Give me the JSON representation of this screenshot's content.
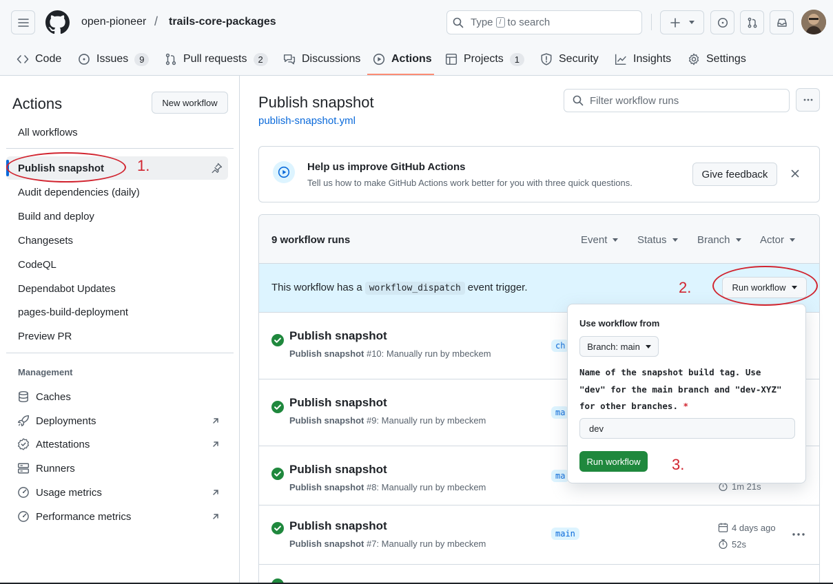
{
  "header": {
    "owner": "open-pioneer",
    "separator": "/",
    "repo": "trails-core-packages",
    "search": {
      "prefix": "Type",
      "key": "/",
      "suffix": "to search"
    }
  },
  "tabs": [
    {
      "label": "Code",
      "icon": "code-icon"
    },
    {
      "label": "Issues",
      "icon": "issue-icon",
      "count": "9"
    },
    {
      "label": "Pull requests",
      "icon": "pull-request-icon",
      "count": "2"
    },
    {
      "label": "Discussions",
      "icon": "discussions-icon"
    },
    {
      "label": "Actions",
      "icon": "play-icon",
      "active": true
    },
    {
      "label": "Projects",
      "icon": "table-icon",
      "count": "1"
    },
    {
      "label": "Security",
      "icon": "shield-icon"
    },
    {
      "label": "Insights",
      "icon": "graph-icon"
    },
    {
      "label": "Settings",
      "icon": "gear-icon"
    }
  ],
  "sidebar": {
    "title": "Actions",
    "new_workflow": "New workflow",
    "all_workflows": "All workflows",
    "workflows": [
      "Publish snapshot",
      "Audit dependencies (daily)",
      "Build and deploy",
      "Changesets",
      "CodeQL",
      "Dependabot Updates",
      "pages-build-deployment",
      "Preview PR"
    ],
    "management_title": "Management",
    "management": [
      {
        "label": "Caches",
        "icon": "database-icon"
      },
      {
        "label": "Deployments",
        "icon": "rocket-icon",
        "external": true
      },
      {
        "label": "Attestations",
        "icon": "verified-icon",
        "external": true
      },
      {
        "label": "Runners",
        "icon": "server-icon"
      },
      {
        "label": "Usage metrics",
        "icon": "meter-icon",
        "external": true
      },
      {
        "label": "Performance metrics",
        "icon": "meter-icon",
        "external": true
      }
    ]
  },
  "main": {
    "title": "Publish snapshot",
    "file": "publish-snapshot.yml",
    "filter_placeholder": "Filter workflow runs",
    "banner": {
      "title": "Help us improve GitHub Actions",
      "subtitle": "Tell us how to make GitHub Actions work better for you with three quick questions.",
      "button": "Give feedback"
    },
    "runs_count": "9 workflow runs",
    "filters": [
      "Event",
      "Status",
      "Branch",
      "Actor"
    ],
    "dispatch": {
      "before": "This workflow has a",
      "code": "workflow_dispatch",
      "after": "event trigger.",
      "button": "Run workflow"
    },
    "runs": [
      {
        "title": "Publish snapshot",
        "name": "Publish snapshot",
        "detail": "#10: Manually run by mbeckem",
        "branch": "ch"
      },
      {
        "title": "Publish snapshot",
        "name": "Publish snapshot",
        "detail": "#9: Manually run by mbeckem",
        "branch": "ma"
      },
      {
        "title": "Publish snapshot",
        "name": "Publish snapshot",
        "detail": "#8: Manually run by mbeckem",
        "branch": "ma",
        "duration": "1m 21s"
      },
      {
        "title": "Publish snapshot",
        "name": "Publish snapshot",
        "detail": "#7: Manually run by mbeckem",
        "branch": "main",
        "date": "4 days ago",
        "duration": "52s"
      }
    ]
  },
  "popup": {
    "label": "Use workflow from",
    "branch_button": "Branch: main",
    "description_lines": [
      "Name of the snapshot build tag. Use",
      "\"dev\" for the main branch and \"dev-XYZ\"",
      "for other branches."
    ],
    "required_mark": "*",
    "input_value": "dev",
    "run_button": "Run workflow"
  },
  "annotations": [
    "1.",
    "2.",
    "3."
  ],
  "colors": {
    "accent": "#0969da",
    "success": "#1f883d",
    "annotation": "#d1242f",
    "tab_underline": "#fd8c73",
    "dispatch_bg": "#ddf4ff"
  }
}
